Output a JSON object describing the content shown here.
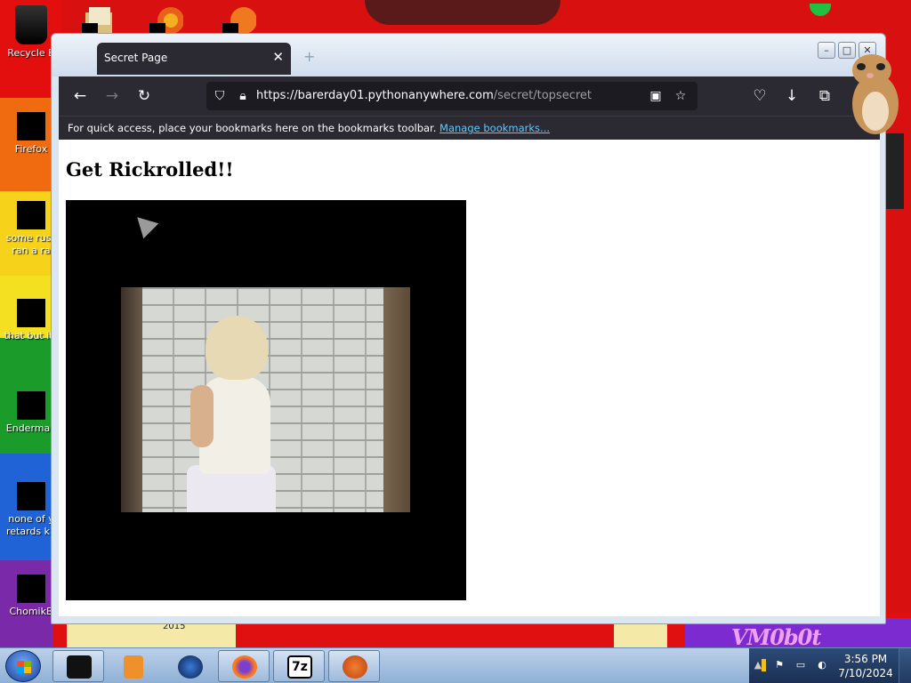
{
  "desktop": {
    "icons": [
      {
        "label": "Recycle B",
        "kind": "recycle-bin-icon"
      },
      {
        "label": "Firefox",
        "kind": "firefox-icon"
      },
      {
        "label": "some russ\nran a ra",
        "kind": "shortcut-icon"
      },
      {
        "label": "that but its",
        "kind": "shortcut-icon"
      },
      {
        "label": "Enderman",
        "kind": "shortcut-icon"
      },
      {
        "label": "none of y\nretards kn",
        "kind": "shortcut-icon"
      },
      {
        "label": "ChomikB",
        "kind": "shortcut-icon"
      }
    ],
    "wallpaper_text": "VM0b0t",
    "wallpaper_small": "2015"
  },
  "browser": {
    "tab_title": "Secret Page",
    "window_controls": {
      "minimize": "–",
      "maximize": "□",
      "close": "✕"
    },
    "url": {
      "host": "https://barerday01.pythonanywhere.com",
      "path": "/secret/topsecret"
    },
    "bookmarks_bar": {
      "message": "For quick access, place your bookmarks here on the bookmarks toolbar.",
      "link": "Manage bookmarks..."
    }
  },
  "page": {
    "heading": "Get Rickrolled!!"
  },
  "taskbar": {
    "apps": [
      {
        "name": "terminal-task",
        "color": "#111111"
      },
      {
        "name": "media-player-task",
        "color": "#f0902a"
      },
      {
        "name": "globe-task",
        "color": "#1c3f8a"
      },
      {
        "name": "firefox-task",
        "color": "#ff7a1a"
      },
      {
        "name": "7zip-task",
        "color": "#000000"
      },
      {
        "name": "paint-task",
        "color": "#e06a20"
      }
    ],
    "clock": {
      "time": "3:56 PM",
      "date": "7/10/2024"
    }
  },
  "colors": {
    "browser_chrome": "#2b2a33",
    "urlbar_bg": "#1c1b22",
    "link": "#5fc8ff"
  }
}
